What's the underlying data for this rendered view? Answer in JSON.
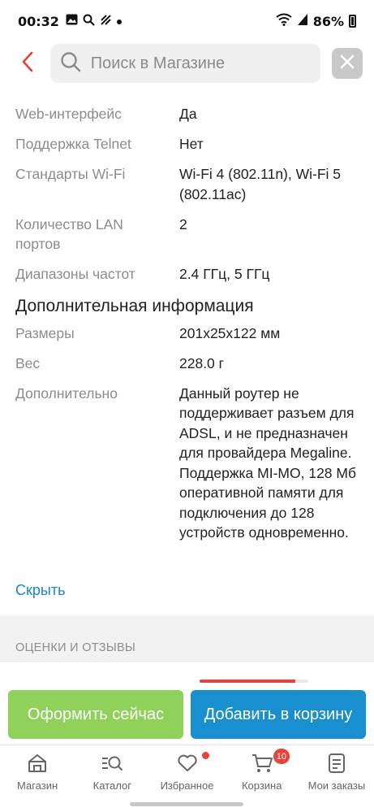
{
  "status_bar": {
    "time": "00:32",
    "battery": "86%"
  },
  "search": {
    "placeholder": "Поиск в Магазине"
  },
  "specs_top": [
    {
      "key": "Web-интерфейс",
      "value": "Да"
    },
    {
      "key": "Поддержка Telnet",
      "value": "Нет"
    },
    {
      "key": "Стандарты Wi-Fi",
      "value": "Wi-Fi 4 (802.11n), Wi-Fi 5 (802.11ac)"
    },
    {
      "key": "Количество LAN портов",
      "value": "2"
    },
    {
      "key": "Диапазоны частот",
      "value": "2.4 ГГц, 5 ГГц"
    }
  ],
  "additional": {
    "title": "Дополнительная информация",
    "specs": [
      {
        "key": "Размеры",
        "value": "201x25x122 мм"
      },
      {
        "key": "Вес",
        "value": "228.0 г"
      },
      {
        "key": "Дополнительно",
        "value": "Данный роутер не поддерживает разъем для ADSL, и не предназначен для провайдера Megaline. Поддержка MI-MO, 128 Мб оперативной памяти для подключения до 128 устройств одновременно."
      }
    ]
  },
  "hide_link": "Скрыть",
  "reviews": {
    "title": "ОЦЕНКИ И ОТЗЫВЫ"
  },
  "actions": {
    "buy_now": "Оформить сейчас",
    "add_to_cart": "Добавить в корзину",
    "buy_color": "#8fd15b",
    "cart_color": "#1a8fd0"
  },
  "nav": [
    {
      "label": "Магазин",
      "icon": "store-icon"
    },
    {
      "label": "Каталог",
      "icon": "catalog-search-icon"
    },
    {
      "label": "Избранное",
      "icon": "heart-icon"
    },
    {
      "label": "Корзина",
      "icon": "cart-icon",
      "badge": "10"
    },
    {
      "label": "Мои заказы",
      "icon": "orders-icon"
    }
  ],
  "colors": {
    "accent_red": "#e8423c",
    "link_blue": "#1c86c6"
  }
}
